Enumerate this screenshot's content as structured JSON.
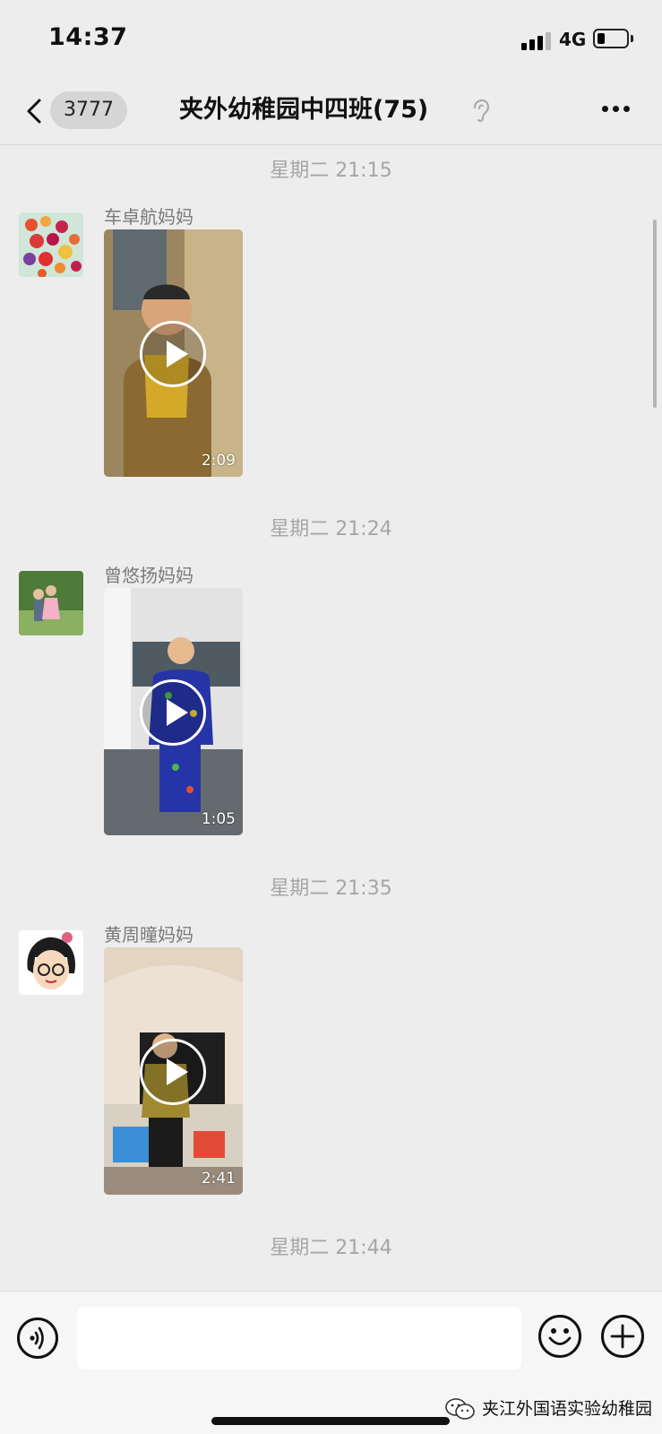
{
  "status_bar": {
    "time": "14:37",
    "network": "4G",
    "signal_bars": 3,
    "signal_max": 4,
    "battery_level": 0.2
  },
  "navbar": {
    "back_count": "3777",
    "title": "夹外幼稚园中四班(75)",
    "muted_icon": "ear-icon",
    "more_icon": "more-icon"
  },
  "messages": [
    {
      "timestamp": "星期二 21:15",
      "sender": "车卓航妈妈",
      "duration": "2:09",
      "avatar_colors": [
        "#f4cf9a",
        "#e8502f"
      ],
      "video_colors": [
        "#8b6a3a",
        "#c9a24a"
      ]
    },
    {
      "timestamp": "星期二 21:24",
      "sender": "曾悠扬妈妈",
      "duration": "1:05",
      "avatar_colors": [
        "#3c6b2f",
        "#88a560"
      ],
      "video_colors": [
        "#dfdfdf",
        "#2d3fa8"
      ]
    },
    {
      "timestamp": "星期二 21:35",
      "sender": "黄周曈妈妈",
      "duration": "2:41",
      "avatar_colors": [
        "#ffffff",
        "#1d1d1d"
      ],
      "video_colors": [
        "#e9d7c1",
        "#6e5a3c"
      ]
    },
    {
      "timestamp": "星期二 21:44"
    }
  ],
  "input_bar": {
    "voice_icon": "voice-icon",
    "emoji_icon": "emoji-icon",
    "plus_icon": "plus-icon",
    "input_value": ""
  },
  "watermark": {
    "text": "夹江外国语实验幼稚园",
    "icon": "wechat-icon"
  }
}
